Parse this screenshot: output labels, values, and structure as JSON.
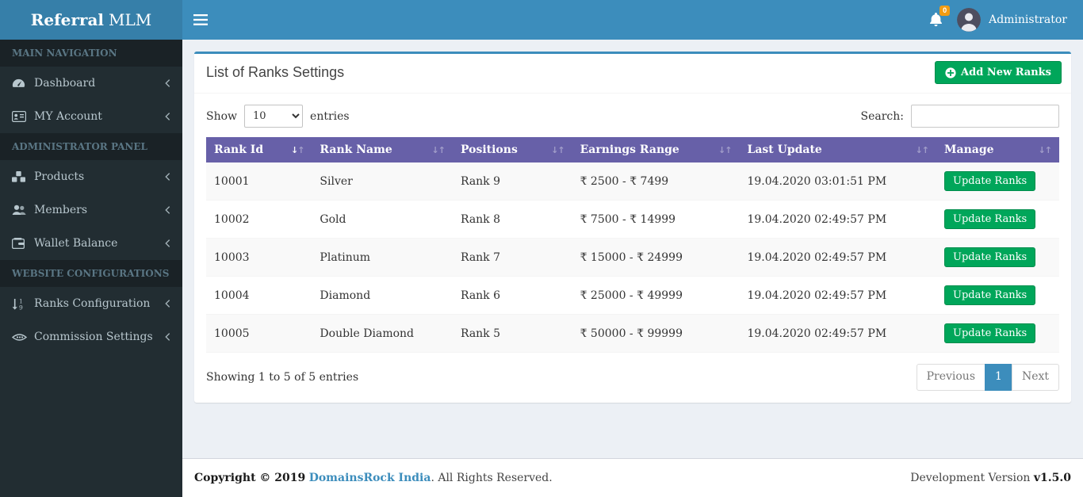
{
  "colors": {
    "navbar_blue": "#3c8dbc",
    "logo_bg_blue": "#367fa9",
    "sidebar_dark": "#222d32",
    "table_header_purple": "#6760a8",
    "success_green": "#00a65a",
    "badge_orange": "#f39c12",
    "content_bg": "#ecf0f5"
  },
  "brand": {
    "name_bold": "Referral",
    "name_light": "MLM"
  },
  "topbar": {
    "notification_count": "0",
    "user_name": "Administrator"
  },
  "sidebar": {
    "sections": [
      {
        "header": "MAIN NAVIGATION",
        "items": [
          {
            "label": "Dashboard",
            "icon": "tachometer-icon"
          },
          {
            "label": "MY Account",
            "icon": "id-card-icon"
          }
        ]
      },
      {
        "header": "ADMINISTRATOR PANEL",
        "items": [
          {
            "label": "Products",
            "icon": "cubes-icon"
          },
          {
            "label": "Members",
            "icon": "users-icon"
          },
          {
            "label": "Wallet Balance",
            "icon": "wallet-icon"
          }
        ]
      },
      {
        "header": "WEBSITE CONFIGURATIONS",
        "items": [
          {
            "label": "Ranks Configuration",
            "icon": "sort-numeric-icon"
          },
          {
            "label": "Commission Settings",
            "icon": "handshake-icon"
          }
        ]
      }
    ]
  },
  "main": {
    "title": "List of Ranks Settings",
    "add_button_label": "Add New Ranks",
    "length_control": {
      "show_label": "Show",
      "selected": "10",
      "entries_label": "entries"
    },
    "search_label": "Search:",
    "search_value": "",
    "table": {
      "columns": [
        "Rank Id",
        "Rank Name",
        "Positions",
        "Earnings Range",
        "Last Update",
        "Manage"
      ],
      "rows": [
        {
          "rank_id": "10001",
          "rank_name": "Silver",
          "position": "Rank 9",
          "earnings": "₹ 2500 - ₹ 7499",
          "last_update": "19.04.2020 03:01:51 PM",
          "action": "Update Ranks"
        },
        {
          "rank_id": "10002",
          "rank_name": "Gold",
          "position": "Rank 8",
          "earnings": "₹ 7500 - ₹ 14999",
          "last_update": "19.04.2020 02:49:57 PM",
          "action": "Update Ranks"
        },
        {
          "rank_id": "10003",
          "rank_name": "Platinum",
          "position": "Rank 7",
          "earnings": "₹ 15000 - ₹ 24999",
          "last_update": "19.04.2020 02:49:57 PM",
          "action": "Update Ranks"
        },
        {
          "rank_id": "10004",
          "rank_name": "Diamond",
          "position": "Rank 6",
          "earnings": "₹ 25000 - ₹ 49999",
          "last_update": "19.04.2020 02:49:57 PM",
          "action": "Update Ranks"
        },
        {
          "rank_id": "10005",
          "rank_name": "Double Diamond",
          "position": "Rank 5",
          "earnings": "₹ 50000 - ₹ 99999",
          "last_update": "19.04.2020 02:49:57 PM",
          "action": "Update Ranks"
        }
      ]
    },
    "info_text": "Showing 1 to 5 of 5 entries",
    "pagination": {
      "previous": "Previous",
      "current_page": "1",
      "next": "Next"
    }
  },
  "footer": {
    "copyright_bold": "Copyright © 2019",
    "brand_link": "DomainsRock India",
    "rights_text": ". All Rights Reserved.",
    "version_label": "Development Version",
    "version_number": "v1.5.0"
  }
}
